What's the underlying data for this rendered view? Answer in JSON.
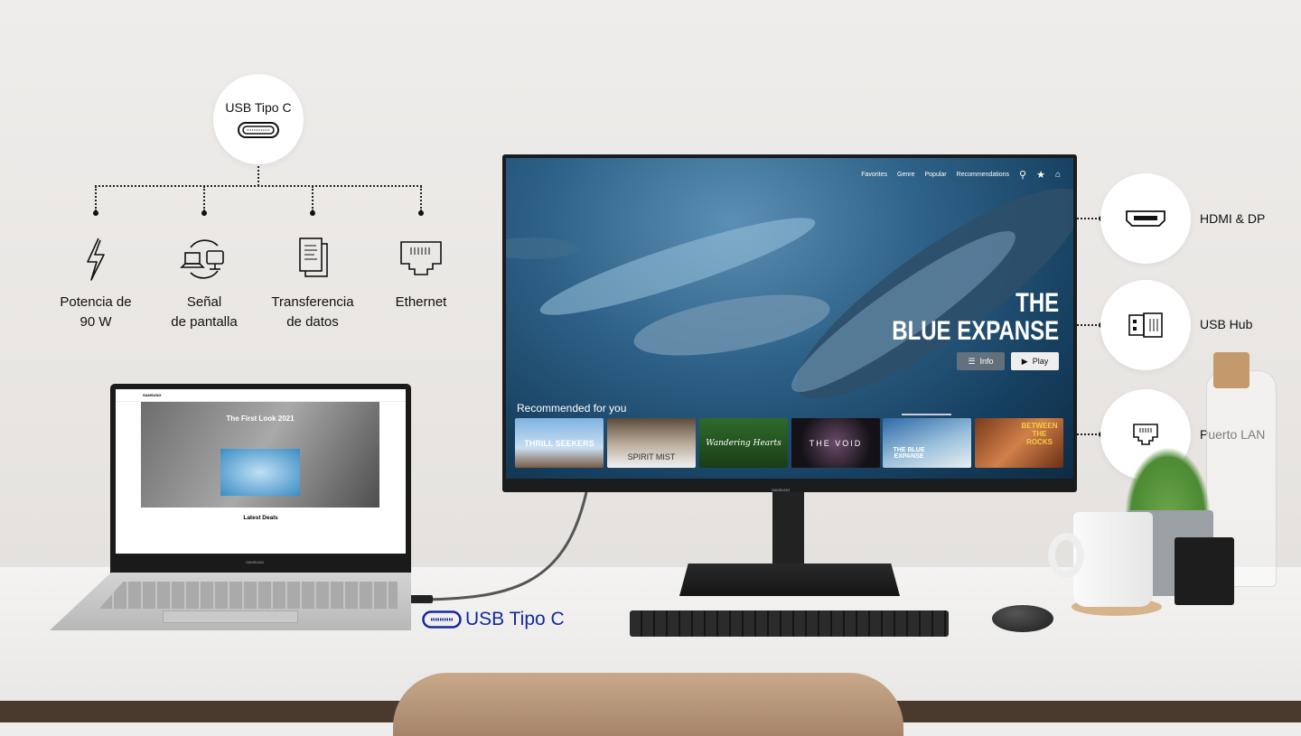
{
  "hub": {
    "title": "USB Tipo C",
    "icon": "usb-c-port-icon"
  },
  "features": [
    {
      "label_line1": "Potencia de",
      "label_line2": "90 W",
      "icon": "lightning-icon"
    },
    {
      "label_line1": "Señal",
      "label_line2": "de pantalla",
      "icon": "screen-sync-icon"
    },
    {
      "label_line1": "Transferencia",
      "label_line2": "de datos",
      "icon": "documents-icon"
    },
    {
      "label_line1": "Ethernet",
      "label_line2": "",
      "icon": "ethernet-port-icon"
    }
  ],
  "ports": [
    {
      "label": "HDMI & DP",
      "icon": "hdmi-port-icon"
    },
    {
      "label": "USB Hub",
      "icon": "usb-port-icon"
    },
    {
      "label": "Puerto LAN",
      "icon": "lan-port-icon"
    }
  ],
  "cable_label": "USB Tipo C",
  "accent_color": "#1428a0",
  "monitor": {
    "brand": "SAMSUNG",
    "nav": [
      "Favorites",
      "Genre",
      "Popular",
      "Recommendations"
    ],
    "title_line1": "THE",
    "title_line2": "BLUE EXPANSE",
    "info_label": "Info",
    "play_label": "Play",
    "recommended_label": "Recommended for you",
    "thumbnails": [
      "THRILL SEEKERS",
      "SPIRIT   MIST",
      "Wandering Hearts",
      "THE VOID",
      "THE BLUE EXPANSE",
      "BETWEEN THE ROCKS"
    ]
  },
  "laptop": {
    "brand": "SAMSUNG",
    "hero_title": "The First Look 2021",
    "section_title": "Latest Deals"
  }
}
